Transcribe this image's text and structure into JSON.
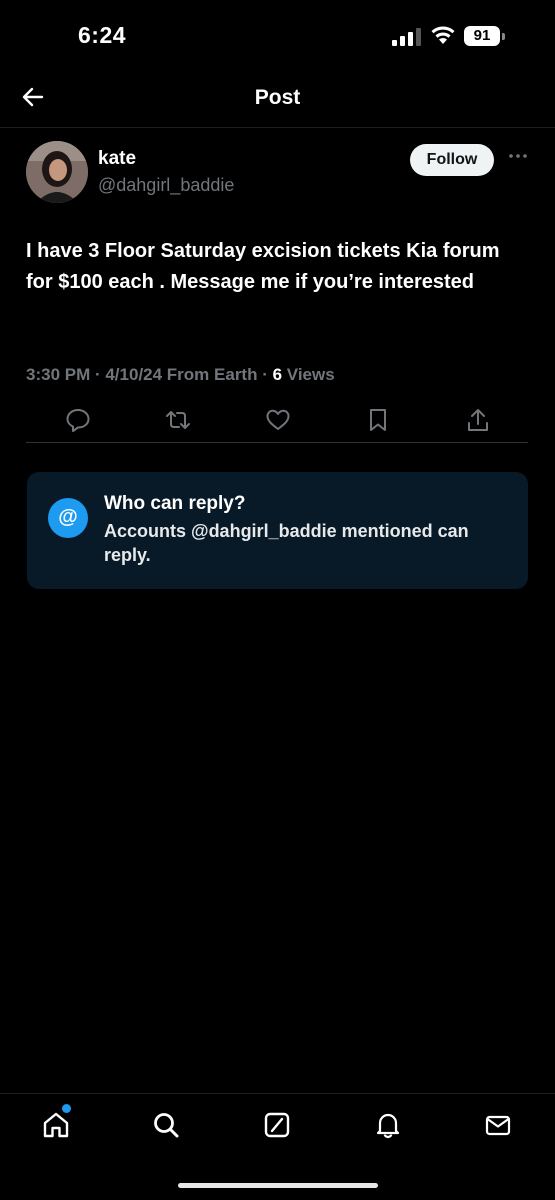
{
  "status_bar": {
    "time": "6:24",
    "battery": "91"
  },
  "header": {
    "title": "Post"
  },
  "post": {
    "author_name": "kate",
    "author_handle": "@dahgirl_baddie",
    "follow_label": "Follow",
    "text": "I have 3 Floor Saturday excision tickets Kia forum for $100 each . Message me if you’re interested",
    "meta_prefix": "3:30 PM · 4/10/24 From Earth · ",
    "views_count": "6",
    "views_label": " Views"
  },
  "reply_settings": {
    "title": "Who can reply?",
    "description": "Accounts @dahgirl_baddie mentioned can reply.",
    "icon": "@"
  },
  "nav": {
    "items": [
      "home-icon",
      "search-icon",
      "grok-icon",
      "notifications-icon",
      "messages-icon"
    ]
  },
  "colors": {
    "accent": "#1d9bf0",
    "muted": "#71767b",
    "reply_box": "#081a28"
  }
}
